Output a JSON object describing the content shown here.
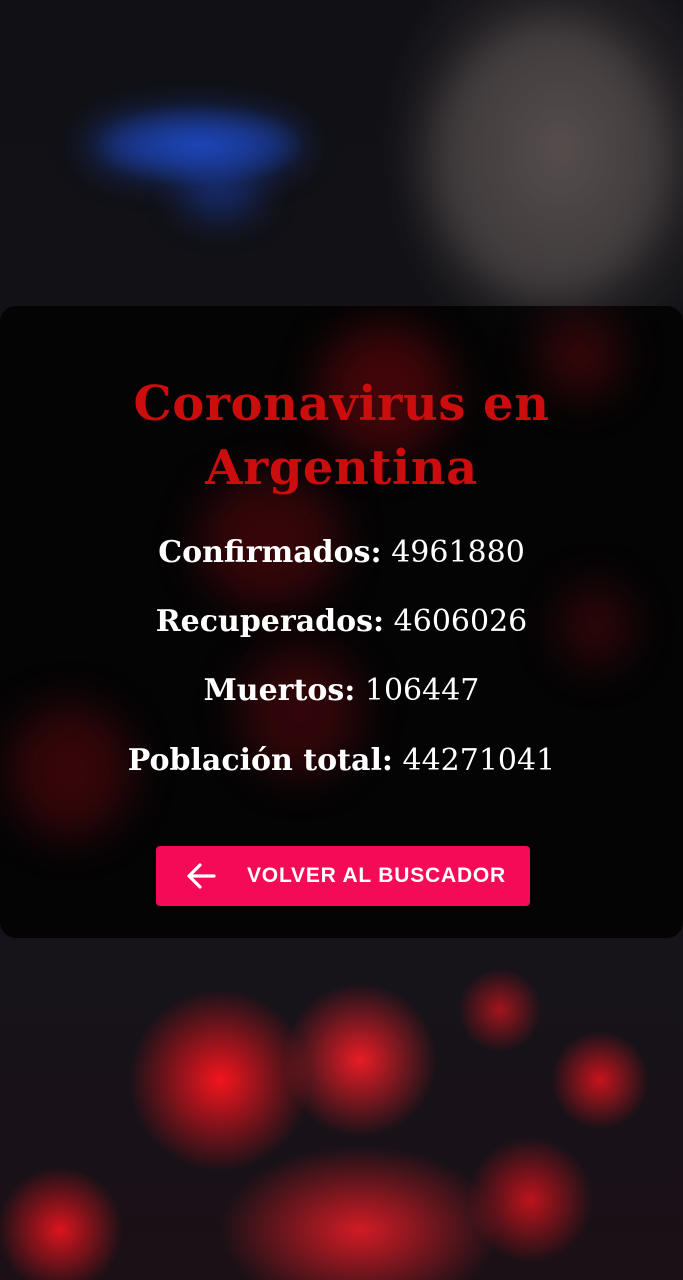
{
  "card": {
    "title": "Coronavirus en Argentina",
    "stats": [
      {
        "label": "Confirmados:",
        "value": "4961880"
      },
      {
        "label": "Recuperados:",
        "value": "4606026"
      },
      {
        "label": "Muertos:",
        "value": "106447"
      },
      {
        "label": "Población total:",
        "value": "44271041"
      }
    ],
    "back_button": {
      "label": "VOLVER AL BUSCADOR",
      "icon": "arrow-left-icon"
    }
  },
  "colors": {
    "title": "#cc0d0d",
    "button": "#f50a57",
    "text": "#ffffff"
  }
}
